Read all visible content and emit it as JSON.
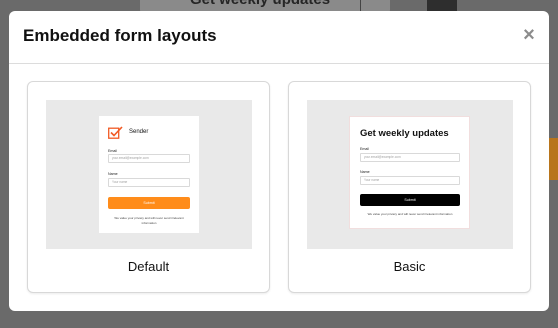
{
  "background": {
    "page_title": "Get weekly updates"
  },
  "modal": {
    "title": "Embedded form layouts",
    "close_symbol": "×",
    "options": [
      {
        "label": "Default",
        "preview": {
          "brand": "Sender",
          "icon": "sender-logo-icon",
          "email_label": "Email",
          "email_placeholder": "your.email@example.com",
          "name_label": "Name",
          "name_placeholder": "Your name",
          "submit_label": "Submit",
          "submit_color": "#ff8c1a",
          "privacy_text": "We value your privacy and will never send irrelevant information"
        }
      },
      {
        "label": "Basic",
        "preview": {
          "heading": "Get weekly updates",
          "email_label": "Email",
          "email_placeholder": "your.email@example.com",
          "name_label": "Name",
          "name_placeholder": "Your name",
          "submit_label": "Submit",
          "submit_color": "#000000",
          "privacy_text": "We value your privacy and will never send irrelevant information"
        }
      }
    ]
  }
}
